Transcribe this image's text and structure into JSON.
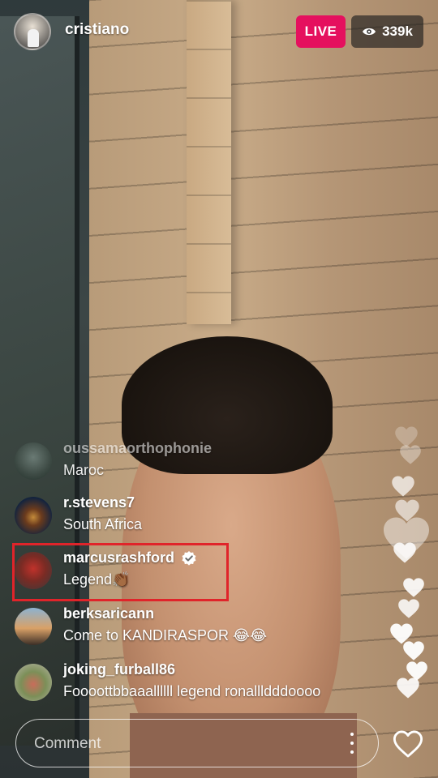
{
  "stream": {
    "username": "cristiano",
    "live_label": "LIVE",
    "viewer_count": "339k"
  },
  "comments": [
    {
      "username": "oussamaorthophonie",
      "text": "Maroc",
      "verified": false
    },
    {
      "username": "r.stevens7",
      "text": "South Africa",
      "verified": false
    },
    {
      "username": "marcusrashford",
      "text": "Legend👏🏾",
      "verified": true,
      "highlighted": true
    },
    {
      "username": "berksaricann",
      "text": "Come to KANDIRASPOR 😂😂",
      "verified": false
    },
    {
      "username": "joking_furball86",
      "text": "Foooottbbaaallllll legend ronallldddoooo",
      "verified": false
    }
  ],
  "composer": {
    "placeholder": "Comment"
  },
  "colors": {
    "live_badge": "#e5105e",
    "highlight_border": "#e0242a"
  },
  "icons": [
    "eye-icon",
    "verified-badge-icon",
    "more-options-icon",
    "heart-icon"
  ]
}
